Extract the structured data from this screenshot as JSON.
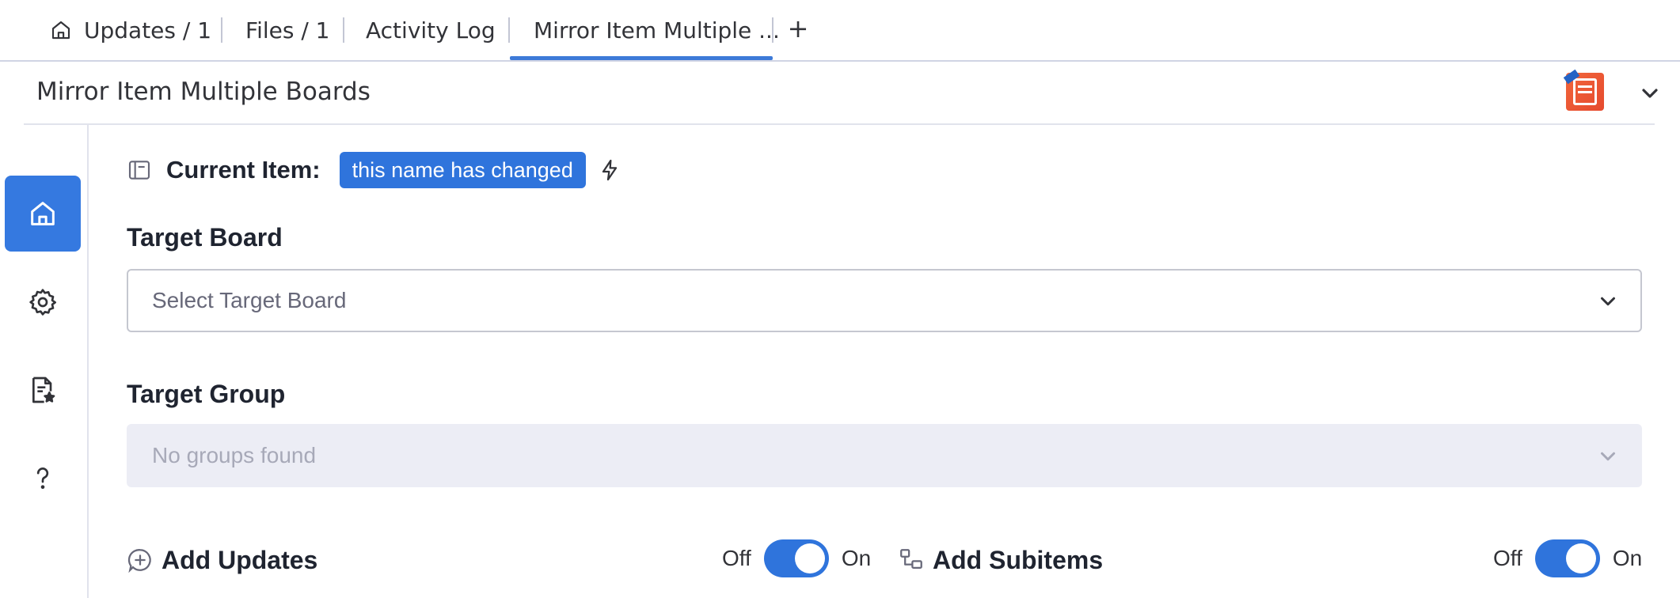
{
  "tabs": [
    {
      "label": "Updates / 1",
      "icon": "home-icon"
    },
    {
      "label": "Files / 1"
    },
    {
      "label": "Activity Log"
    },
    {
      "label": "Mirror Item Multiple ...",
      "active": true
    }
  ],
  "tab_add_label": "+",
  "header": {
    "title": "Mirror Item Multiple Boards",
    "logo_icon": "app-logo-icon",
    "menu_icon": "chevron-down-icon"
  },
  "sidenav": [
    {
      "icon": "home-icon",
      "active": true
    },
    {
      "icon": "gear-icon"
    },
    {
      "icon": "document-magic-icon"
    },
    {
      "icon": "help-icon"
    }
  ],
  "current_item": {
    "label": "Current Item:",
    "value": "this name has changed"
  },
  "target_board": {
    "label": "Target Board",
    "placeholder": "Select Target Board"
  },
  "target_group": {
    "label": "Target Group",
    "placeholder": "No groups found"
  },
  "add_updates": {
    "label": "Add Updates",
    "off_label": "Off",
    "on_label": "On",
    "enabled": true
  },
  "add_subitems": {
    "label": "Add Subitems",
    "off_label": "Off",
    "on_label": "On",
    "enabled": true
  },
  "colors": {
    "accent": "#2f74dc",
    "tab_underline": "#3d7ad8",
    "disabled_bg": "#ecedf5"
  }
}
